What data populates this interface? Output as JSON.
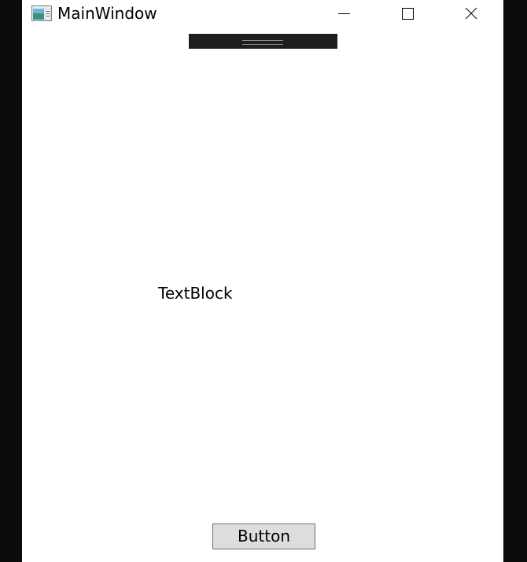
{
  "window": {
    "title": "MainWindow"
  },
  "title_bar": {
    "icons": [
      "app-icon",
      "minimize-icon",
      "maximize-icon",
      "close-icon"
    ]
  },
  "content": {
    "text_block": "TextBlock",
    "button_label": "Button"
  },
  "colors": {
    "outer_background": "#0b0b0b",
    "window_background": "#ffffff",
    "button_background": "#dddddd",
    "button_border": "#707070",
    "dev_toolbar": "#1e1e1e"
  }
}
